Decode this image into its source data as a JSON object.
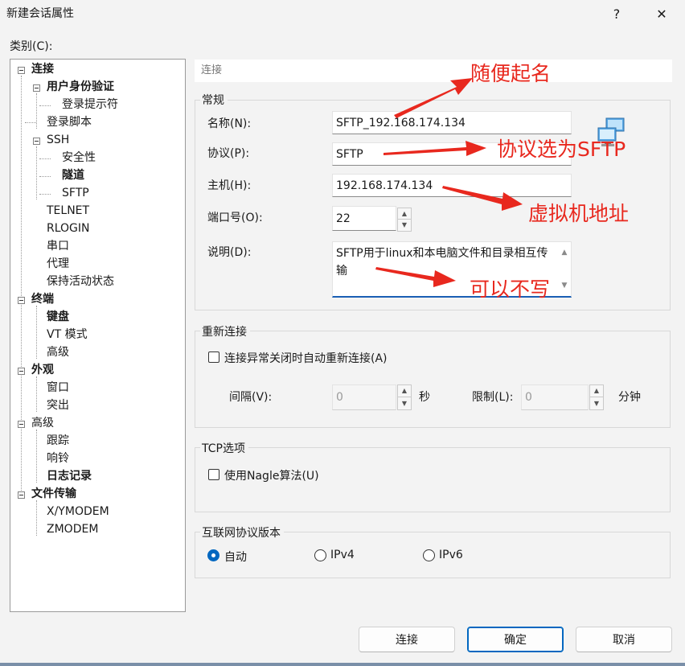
{
  "window": {
    "title": "新建会话属性",
    "help": "?",
    "close": "✕"
  },
  "category_label": "类别(C):",
  "tree": [
    {
      "label": "连接",
      "bold": true
    },
    {
      "label": "用户身份验证",
      "bold": true
    },
    {
      "label": "登录提示符",
      "bold": false
    },
    {
      "label": "登录脚本",
      "bold": false
    },
    {
      "label": "SSH",
      "bold": false
    },
    {
      "label": "安全性",
      "bold": false
    },
    {
      "label": "隧道",
      "bold": true
    },
    {
      "label": "SFTP",
      "bold": false
    },
    {
      "label": "TELNET",
      "bold": false
    },
    {
      "label": "RLOGIN",
      "bold": false
    },
    {
      "label": "串口",
      "bold": false
    },
    {
      "label": "代理",
      "bold": false
    },
    {
      "label": "保持活动状态",
      "bold": false
    },
    {
      "label": "终端",
      "bold": true
    },
    {
      "label": "键盘",
      "bold": true
    },
    {
      "label": "VT 模式",
      "bold": false
    },
    {
      "label": "高级",
      "bold": false
    },
    {
      "label": "外观",
      "bold": true
    },
    {
      "label": "窗口",
      "bold": false
    },
    {
      "label": "突出",
      "bold": false
    },
    {
      "label": "高级",
      "bold": false
    },
    {
      "label": "跟踪",
      "bold": false
    },
    {
      "label": "响铃",
      "bold": false
    },
    {
      "label": "日志记录",
      "bold": true
    },
    {
      "label": "文件传输",
      "bold": true
    },
    {
      "label": "X/YMODEM",
      "bold": false
    },
    {
      "label": "ZMODEM",
      "bold": false
    }
  ],
  "section_header": "连接",
  "general": {
    "title": "常规",
    "name_label": "名称(N):",
    "name_value": "SFTP_192.168.174.134",
    "protocol_label": "协议(P):",
    "protocol_value": "SFTP",
    "host_label": "主机(H):",
    "host_value": "192.168.174.134",
    "port_label": "端口号(O):",
    "port_value": "22",
    "desc_label": "说明(D):",
    "desc_value": "SFTP用于linux和本电脑文件和目录相互传输"
  },
  "reconnect": {
    "title": "重新连接",
    "checkbox_label": "连接异常关闭时自动重新连接(A)",
    "interval_label": "间隔(V):",
    "interval_value": "0",
    "interval_unit": "秒",
    "limit_label": "限制(L):",
    "limit_value": "0",
    "limit_unit": "分钟"
  },
  "tcp": {
    "title": "TCP选项",
    "nagle_label": "使用Nagle算法(U)"
  },
  "ip_version": {
    "title": "互联网协议版本",
    "options": [
      "自动",
      "IPv4",
      "IPv6"
    ],
    "selected": "自动"
  },
  "buttons": {
    "connect": "连接",
    "ok": "确定",
    "cancel": "取消"
  },
  "annotations": {
    "name_note": "随便起名",
    "protocol_note": "协议选为SFTP",
    "host_note": "虚拟机地址",
    "desc_note": "可以不写"
  },
  "colors": {
    "accent": "#0067c0",
    "annotation": "#e8281e"
  }
}
